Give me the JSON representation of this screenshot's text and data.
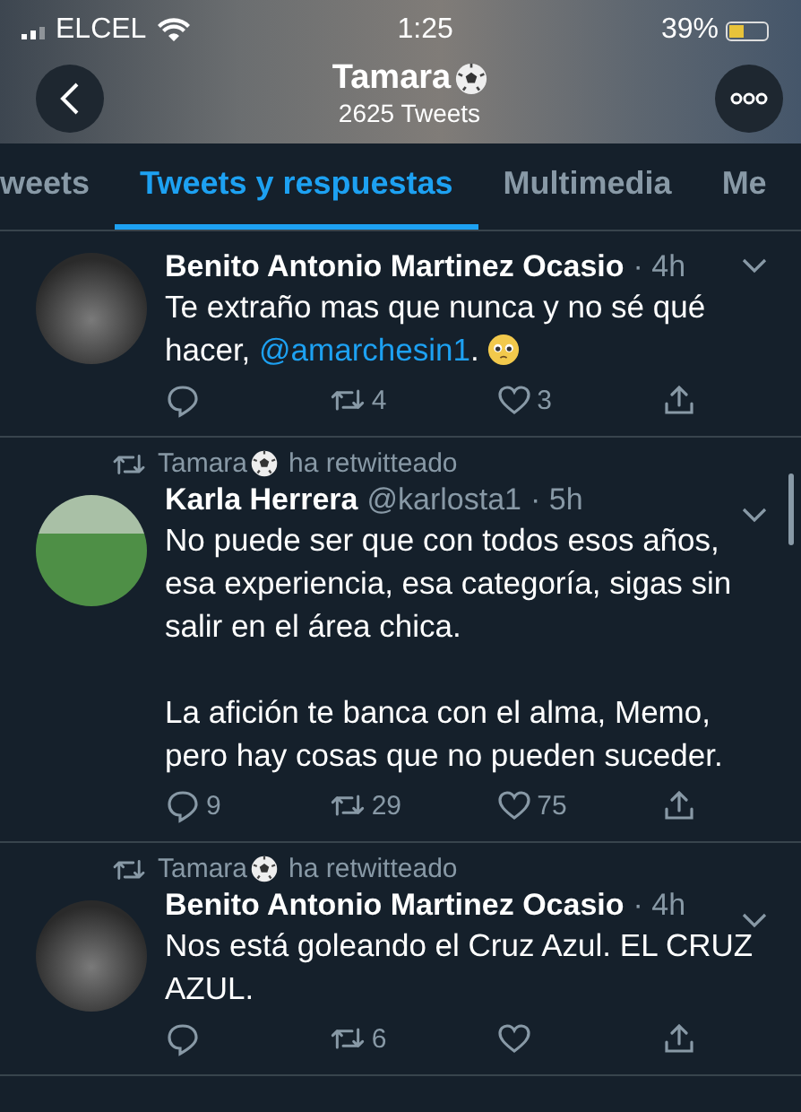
{
  "status_bar": {
    "carrier": "ELCEL",
    "time": "1:25",
    "battery": "39%"
  },
  "header": {
    "name": "Tamara",
    "tweet_count": "2625 Tweets"
  },
  "tabs": [
    {
      "label": "weets",
      "selected": false
    },
    {
      "label": "Tweets y respuestas",
      "selected": true
    },
    {
      "label": "Multimedia",
      "selected": false
    },
    {
      "label": "Me",
      "selected": false
    }
  ],
  "tweets": [
    {
      "name": "Benito Antonio Martinez Ocasio",
      "time": "· 4h",
      "paragraphs": [
        [
          {
            "kind": "text",
            "text": "Te extraño mas que nunca y no sé qué hacer, "
          },
          {
            "kind": "mention",
            "text": "@amarchesin1"
          },
          {
            "kind": "text",
            "text": ". "
          },
          {
            "kind": "emoji"
          }
        ]
      ],
      "retweets": "4",
      "likes": "3"
    },
    {
      "retweeted_by": "Tamara",
      "retweet_label": "ha retwitteado",
      "name": "Karla Herrera",
      "handle": "@karlosta1",
      "time": "· 5h",
      "avatar": {
        "kind": "field"
      },
      "paragraphs": [
        [
          {
            "kind": "text",
            "text": "No puede ser que con todos esos años, esa experiencia, esa categoría, sigas sin salir en el área chica."
          }
        ],
        [
          {
            "kind": "text",
            "text": "La afición te banca con el alma, Memo, pero hay cosas que no pueden suceder."
          }
        ]
      ],
      "replies": "9",
      "retweets": "29",
      "likes": "75"
    },
    {
      "retweeted_by": "Tamara",
      "retweet_label": "ha retwitteado",
      "name": "Benito Antonio Martinez Ocasio",
      "time": "· 4h",
      "paragraphs": [
        [
          {
            "kind": "text",
            "text": "Nos está goleando el Cruz Azul. EL CRUZ AZUL."
          }
        ]
      ],
      "retweets": "6"
    }
  ]
}
